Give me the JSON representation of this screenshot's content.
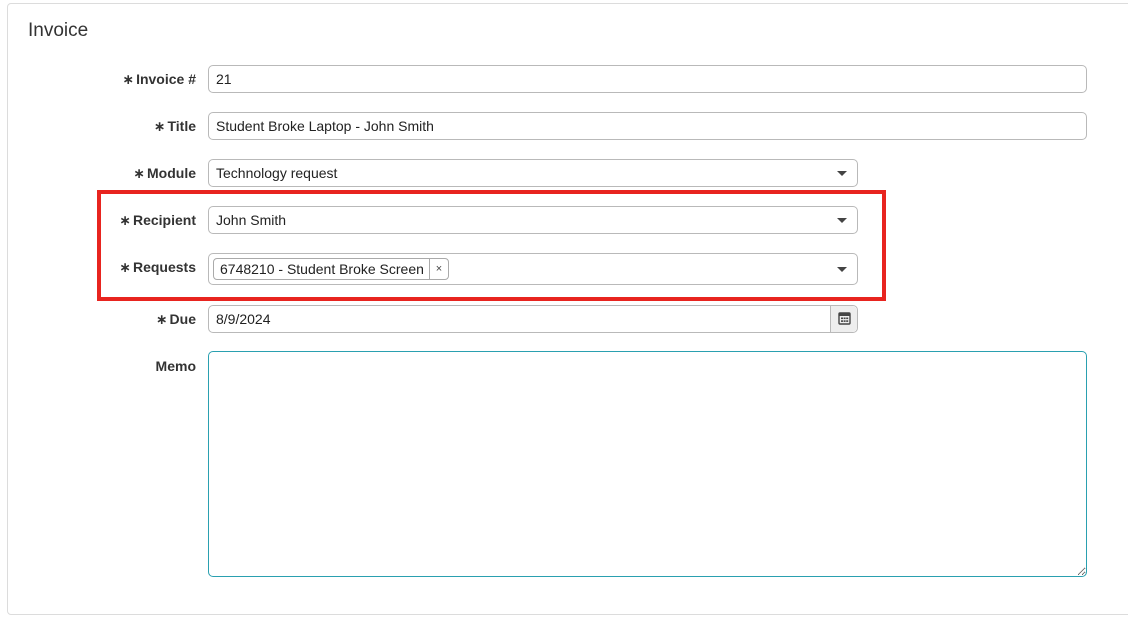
{
  "form": {
    "title": "Invoice",
    "required_mark": "∗",
    "invoice_number": {
      "label": "Invoice #",
      "value": "21"
    },
    "title_field": {
      "label": "Title",
      "value": "Student Broke Laptop - John Smith"
    },
    "module": {
      "label": "Module",
      "value": "Technology request"
    },
    "recipient": {
      "label": "Recipient",
      "value": "John Smith"
    },
    "requests": {
      "label": "Requests",
      "tags": [
        {
          "text": "6748210 - Student Broke Screen",
          "remove": "×"
        }
      ]
    },
    "due": {
      "label": "Due",
      "value": "8/9/2024"
    },
    "memo": {
      "label": "Memo",
      "value": ""
    }
  },
  "highlight_color": "#e8241f",
  "icons": {
    "dropdown": "chevron-down-icon",
    "calendar": "calendar-icon",
    "remove": "close-icon"
  }
}
